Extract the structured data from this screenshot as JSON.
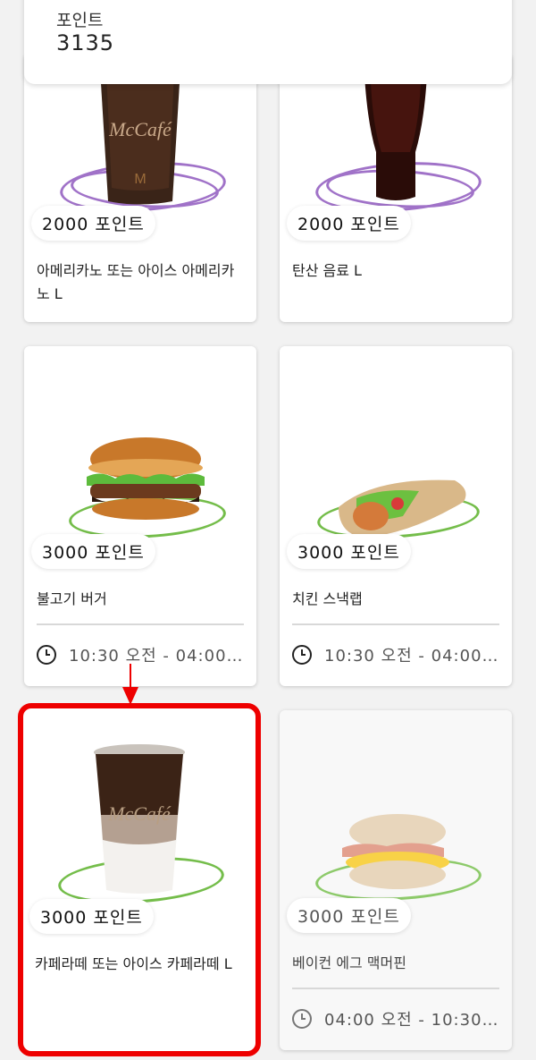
{
  "header": {
    "points_label": "포인트",
    "points_value": "3135"
  },
  "colors": {
    "ring_purple": "#a072c8",
    "ring_green": "#74bd4a",
    "highlight": "#ee0000"
  },
  "cards": [
    {
      "points": "2000 포인트",
      "title": "아메리카노 또는 아이스 아메리카노 L",
      "icon": "iced-coffee-image"
    },
    {
      "points": "2000 포인트",
      "title": "탄산 음료 L",
      "icon": "coca-cola-image"
    },
    {
      "points": "3000 포인트",
      "title": "불고기 버거",
      "time": "10:30 오전 - 04:00…",
      "icon": "burger-image"
    },
    {
      "points": "3000 포인트",
      "title": "치킨 스낵랩",
      "time": "10:30 오전 - 04:00…",
      "icon": "snack-wrap-image"
    },
    {
      "points": "3000 포인트",
      "title": "카페라떼 또는 아이스 카페라떼 L",
      "icon": "iced-latte-image"
    },
    {
      "points": "3000 포인트",
      "title": "베이컨 에그 맥머핀",
      "time": "04:00 오전 - 10:30…",
      "icon": "muffin-image"
    }
  ]
}
